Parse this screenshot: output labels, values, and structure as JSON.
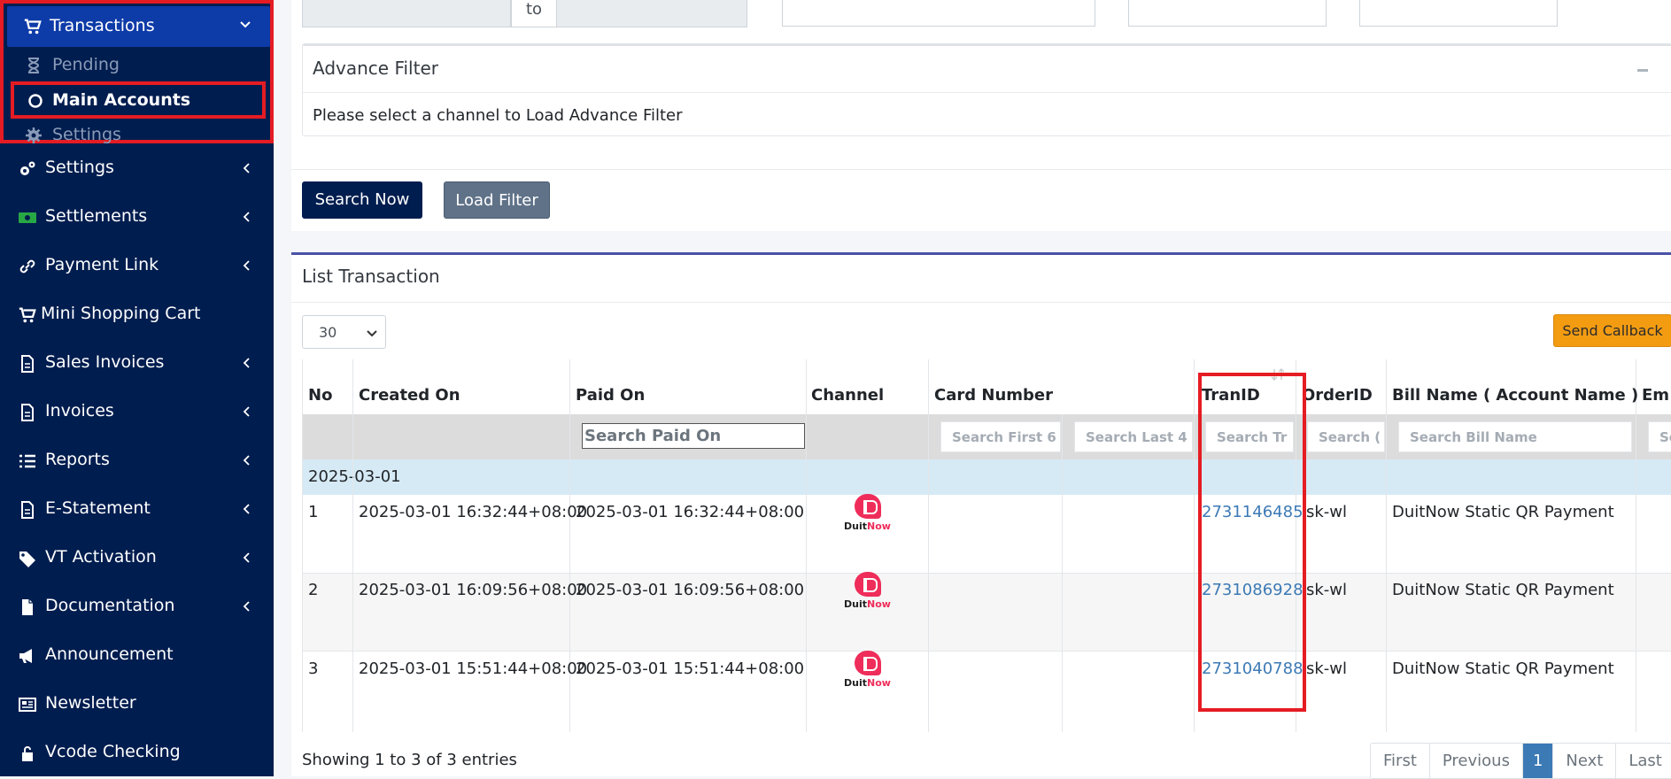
{
  "sidebar": {
    "transactions": {
      "label": "Transactions",
      "icon": "cart-icon"
    },
    "sub_items": [
      {
        "label": "Pending",
        "icon": "hourglass-icon"
      },
      {
        "label": "Main Accounts",
        "icon": "circle-icon"
      },
      {
        "label": "Settings",
        "icon": "gear-icon"
      }
    ],
    "items": [
      {
        "label": "Settings",
        "icon": "gears-icon",
        "has_children": true
      },
      {
        "label": "Settlements",
        "icon": "money-icon",
        "has_children": true
      },
      {
        "label": "Payment Link",
        "icon": "link-icon",
        "has_children": true
      },
      {
        "label": "Mini Shopping Cart",
        "icon": "cart-icon",
        "has_children": false
      },
      {
        "label": "Sales Invoices",
        "icon": "file-icon",
        "has_children": true
      },
      {
        "label": "Invoices",
        "icon": "file-icon",
        "has_children": true
      },
      {
        "label": "Reports",
        "icon": "list-icon",
        "has_children": true
      },
      {
        "label": "E-Statement",
        "icon": "file-icon",
        "has_children": true
      },
      {
        "label": "VT Activation",
        "icon": "tag-icon",
        "has_children": true
      },
      {
        "label": "Documentation",
        "icon": "document-icon",
        "has_children": true
      },
      {
        "label": "Announcement",
        "icon": "megaphone-icon",
        "has_children": false
      },
      {
        "label": "Newsletter",
        "icon": "newspaper-icon",
        "has_children": false
      },
      {
        "label": "Vcode Checking",
        "icon": "lock-icon",
        "has_children": false
      }
    ],
    "colors": {
      "bg": "#001d4f",
      "active": "#0d3ba8",
      "highlight": "#e51c23"
    }
  },
  "filters": {
    "date_range_to": "to",
    "advance_filter": {
      "title": "Advance Filter",
      "message": "Please select a channel to Load Advance Filter"
    },
    "search_button": "Search Now",
    "load_filter_button": "Load Filter"
  },
  "list": {
    "title": "List Transaction",
    "page_size": "30",
    "send_callback_button": "Send Callback",
    "columns": [
      "No",
      "Created On",
      "Paid On",
      "Channel",
      "Card Number",
      "TranID",
      "OrderID",
      "Bill Name ( Account Name )",
      "Em"
    ],
    "filter_placeholders": {
      "paid_on": "Search Paid On",
      "card_first6": "Search First 6",
      "card_last4": "Search Last 4",
      "tranid": "Search Tr",
      "orderid": "Search (",
      "bill_name": "Search Bill Name",
      "email": "Se"
    },
    "group_date": "2025-03-01",
    "rows": [
      {
        "no": "1",
        "created_on": "2025-03-01 16:32:44+08:00",
        "paid_on": "2025-03-01 16:32:44+08:00",
        "channel": "DuitNow",
        "tranid": "2731146485",
        "orderid": "isk-wl",
        "bill_name": "DuitNow Static QR Payment"
      },
      {
        "no": "2",
        "created_on": "2025-03-01 16:09:56+08:00",
        "paid_on": "2025-03-01 16:09:56+08:00",
        "channel": "DuitNow",
        "tranid": "2731086928",
        "orderid": "isk-wl",
        "bill_name": "DuitNow Static QR Payment"
      },
      {
        "no": "3",
        "created_on": "2025-03-01 15:51:44+08:00",
        "paid_on": "2025-03-01 15:51:44+08:00",
        "channel": "DuitNow",
        "tranid": "2731040788",
        "orderid": "isk-wl",
        "bill_name": "DuitNow Static QR Payment"
      }
    ],
    "info": "Showing 1 to 3 of 3 entries",
    "pagination": [
      "First",
      "Previous",
      "1",
      "Next",
      "Last"
    ],
    "current_page": "1",
    "colors": {
      "link": "#3c7ab5",
      "callback": "#f39c12",
      "group_row": "#d6eaf5"
    }
  }
}
